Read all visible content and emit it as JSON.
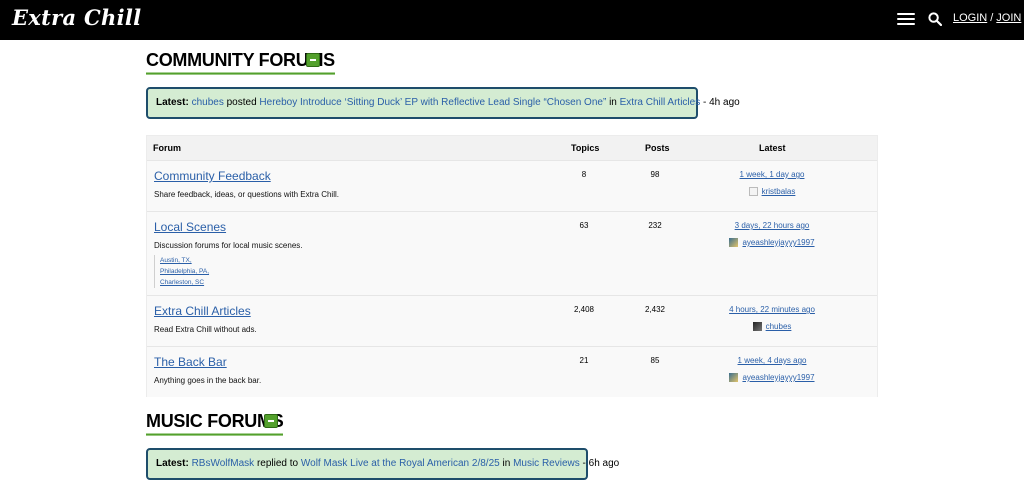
{
  "header": {
    "logo": "Extra Chill",
    "login": "LOGIN",
    "separator": "/",
    "join": "JOIN"
  },
  "community": {
    "title": "COMMUNITY FORUMS",
    "latest": {
      "label": "Latest:",
      "user": "chubes",
      "verb": "posted",
      "topic": "Hereboy Introduce ‘Sitting Duck’ EP with Reflective Lead Single “Chosen One”",
      "in": "in",
      "forum": "Extra Chill Articles",
      "time": "- 4h ago"
    }
  },
  "table": {
    "headers": {
      "forum": "Forum",
      "topics": "Topics",
      "posts": "Posts",
      "latest": "Latest"
    },
    "rows": [
      {
        "name": "Community Feedback",
        "desc": "Share feedback, ideas, or questions with Extra Chill.",
        "topics": "8",
        "posts": "98",
        "latest_time": "1 week, 1 day ago",
        "latest_user": "kristbalas"
      },
      {
        "name": "Local Scenes",
        "desc": "Discussion forums for local music scenes.",
        "topics": "63",
        "posts": "232",
        "latest_time": "3 days, 22 hours ago",
        "latest_user": "ayeashleyjayyy1997",
        "subforums": [
          "Austin, TX,",
          "Philadelphia, PA,",
          "Charleston, SC"
        ]
      },
      {
        "name": "Extra Chill Articles",
        "desc": "Read Extra Chill without ads.",
        "topics": "2,408",
        "posts": "2,432",
        "latest_time": "4 hours, 22 minutes ago",
        "latest_user": "chubes"
      },
      {
        "name": "The Back Bar",
        "desc": "Anything goes in the back bar.",
        "topics": "21",
        "posts": "85",
        "latest_time": "1 week, 4 days ago",
        "latest_user": "ayeashleyjayyy1997"
      }
    ]
  },
  "music": {
    "title": "MUSIC FORUMS",
    "latest": {
      "label": "Latest:",
      "user": "RBsWolfMask",
      "verb": "replied to",
      "topic": "Wolf Mask Live at the Royal American 2/8/25",
      "in": "in",
      "forum": "Music Reviews",
      "time": "- 6h ago"
    }
  },
  "colors": {
    "accent_green": "#53a02c",
    "latest_bg": "#d4ecd2",
    "latest_border": "#1e4d6b",
    "link": "#2a5fa8"
  }
}
